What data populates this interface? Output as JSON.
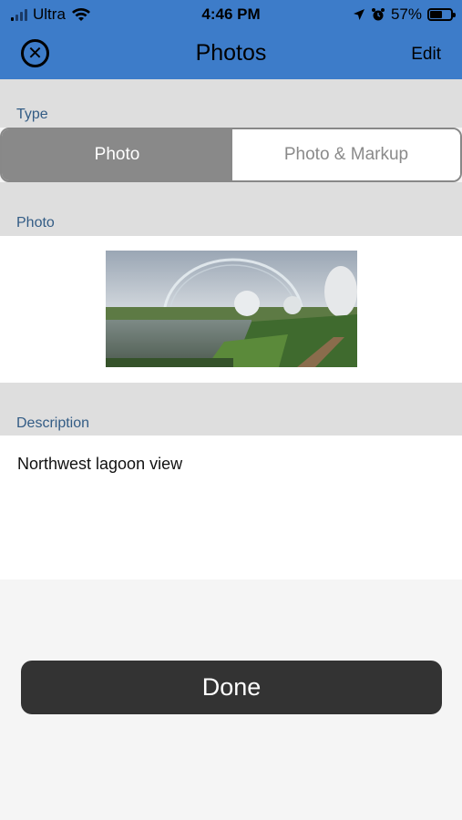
{
  "status_bar": {
    "carrier": "Ultra",
    "time": "4:46 PM",
    "battery_percent": "57%",
    "battery_level": 0.57
  },
  "nav": {
    "title": "Photos",
    "edit_label": "Edit",
    "close_icon": "close-icon",
    "close_glyph": "✕"
  },
  "type_section": {
    "label": "Type",
    "options": [
      "Photo",
      "Photo & Markup"
    ],
    "selected": "Photo"
  },
  "photo_section": {
    "label": "Photo"
  },
  "description_section": {
    "label": "Description",
    "value": "Northwest lagoon view"
  },
  "done_label": "Done",
  "colors": {
    "header_bg": "#3d7cc9",
    "section_bg": "#dedede",
    "label_color": "#335c85",
    "segment_active": "#898989",
    "done_bg": "#333333"
  }
}
